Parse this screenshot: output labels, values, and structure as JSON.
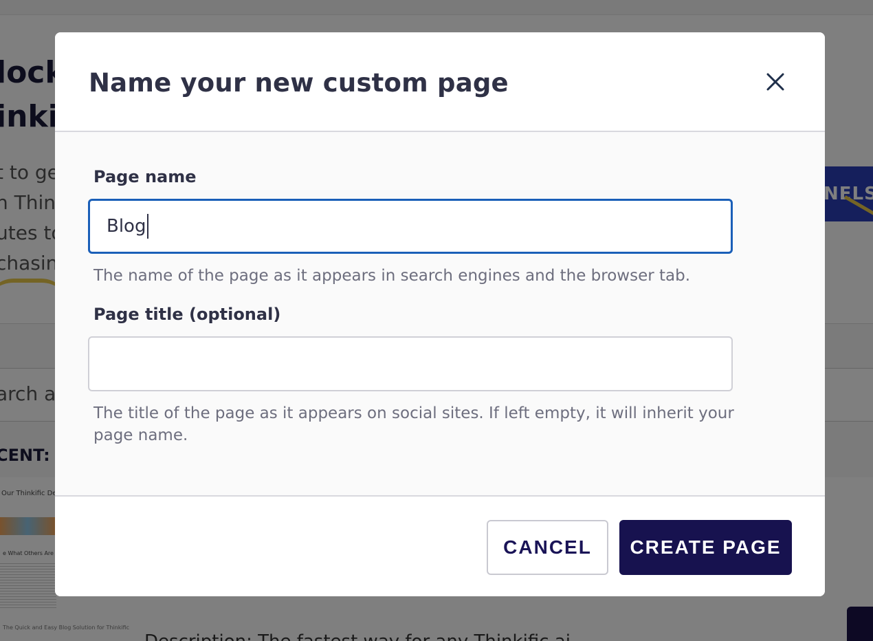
{
  "background": {
    "heading_line1": "lock",
    "heading_line2": "inkit",
    "para_line1": "t to ge",
    "para_line2": "n Think",
    "para_line3": "utes to",
    "para_line4": "chasing",
    "panel_button": "NELS",
    "search_fragment": "arch al",
    "recent_label": "CENT:",
    "thumb_title": "Our Thinkific Demo W",
    "thumb_subtitle": "e What Others Are Saying",
    "thumb_caption": "The Quick and Easy Blog Solution for Thinkific",
    "bottom_text": "Description: The fastest way for any Thinkific ai"
  },
  "modal": {
    "title": "Name your new custom page",
    "page_name_label": "Page name",
    "page_name_value": "Blog",
    "page_name_help": "The name of the page as it appears in search engines and the browser tab.",
    "page_title_label": "Page title (optional)",
    "page_title_value": "",
    "page_title_help": "The title of the page as it appears on social sites. If left empty, it will inherit your page name.",
    "cancel_label": "CANCEL",
    "create_label": "CREATE PAGE"
  },
  "colors": {
    "primary_button": "#17124f",
    "focus_border": "#1a5fb8",
    "title_text": "#2f3146",
    "help_text": "#6d6e7e"
  },
  "icons": {
    "close": "close-icon"
  }
}
